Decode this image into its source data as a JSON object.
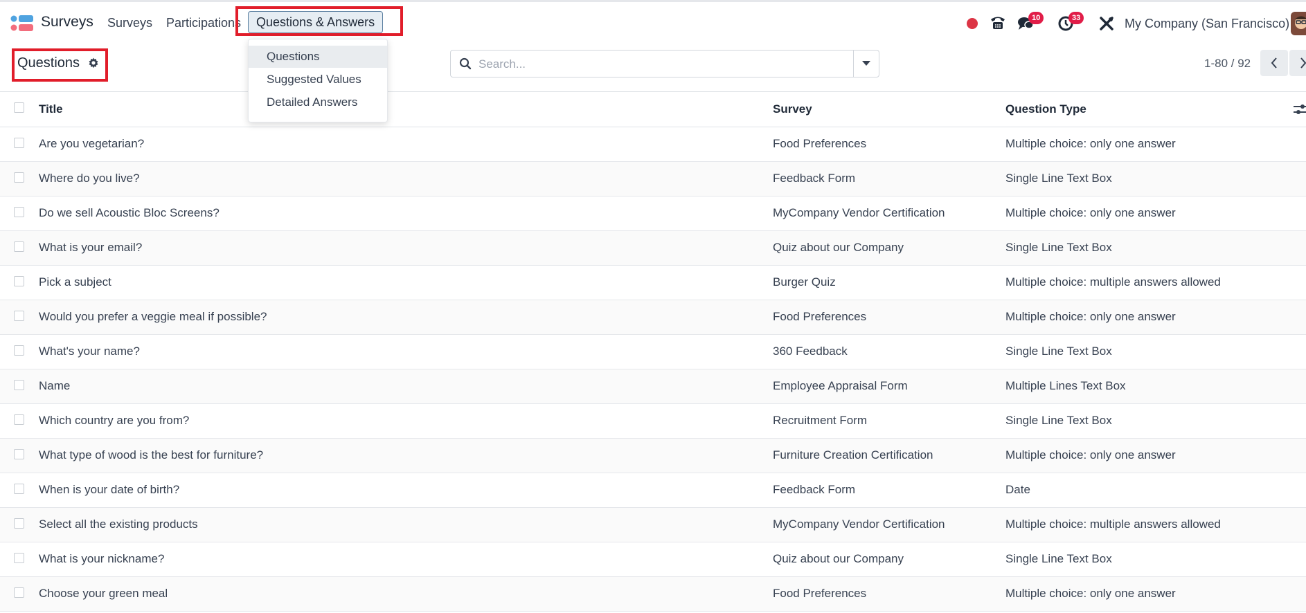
{
  "navbar": {
    "app_name": "Surveys",
    "menus": [
      "Surveys",
      "Participations",
      "Questions & Answers"
    ],
    "company": "My Company (San Francisco)",
    "messages_badge": "10",
    "activities_badge": "33"
  },
  "dropdown": {
    "items": [
      "Questions",
      "Suggested Values",
      "Detailed Answers"
    ]
  },
  "control_panel": {
    "title": "Questions",
    "search_placeholder": "Search...",
    "pager": "1-80 / 92"
  },
  "table": {
    "headers": [
      "Title",
      "Survey",
      "Question Type"
    ],
    "rows": [
      [
        "Are you vegetarian?",
        "Food Preferences",
        "Multiple choice: only one answer"
      ],
      [
        "Where do you live?",
        "Feedback Form",
        "Single Line Text Box"
      ],
      [
        "Do we sell Acoustic Bloc Screens?",
        "MyCompany Vendor Certification",
        "Multiple choice: only one answer"
      ],
      [
        "What is your email?",
        "Quiz about our Company",
        "Single Line Text Box"
      ],
      [
        "Pick a subject",
        "Burger Quiz",
        "Multiple choice: multiple answers allowed"
      ],
      [
        "Would you prefer a veggie meal if possible?",
        "Food Preferences",
        "Multiple choice: only one answer"
      ],
      [
        "What's your name?",
        "360 Feedback",
        "Single Line Text Box"
      ],
      [
        "Name",
        "Employee Appraisal Form",
        "Multiple Lines Text Box"
      ],
      [
        "Which country are you from?",
        "Recruitment Form",
        "Single Line Text Box"
      ],
      [
        "What type of wood is the best for furniture?",
        "Furniture Creation Certification",
        "Multiple choice: only one answer"
      ],
      [
        "When is your date of birth?",
        "Feedback Form",
        "Date"
      ],
      [
        "Select all the existing products",
        "MyCompany Vendor Certification",
        "Multiple choice: multiple answers allowed"
      ],
      [
        "What is your nickname?",
        "Quiz about our Company",
        "Single Line Text Box"
      ],
      [
        "Choose your green meal",
        "Food Preferences",
        "Multiple choice: only one answer"
      ]
    ]
  },
  "colors": {
    "highlight": "#e11d2a",
    "badge": "#e11d48",
    "record_dot": "#dc3545",
    "logo_blue": "#4fa3e0",
    "logo_red": "#f26d7d"
  }
}
